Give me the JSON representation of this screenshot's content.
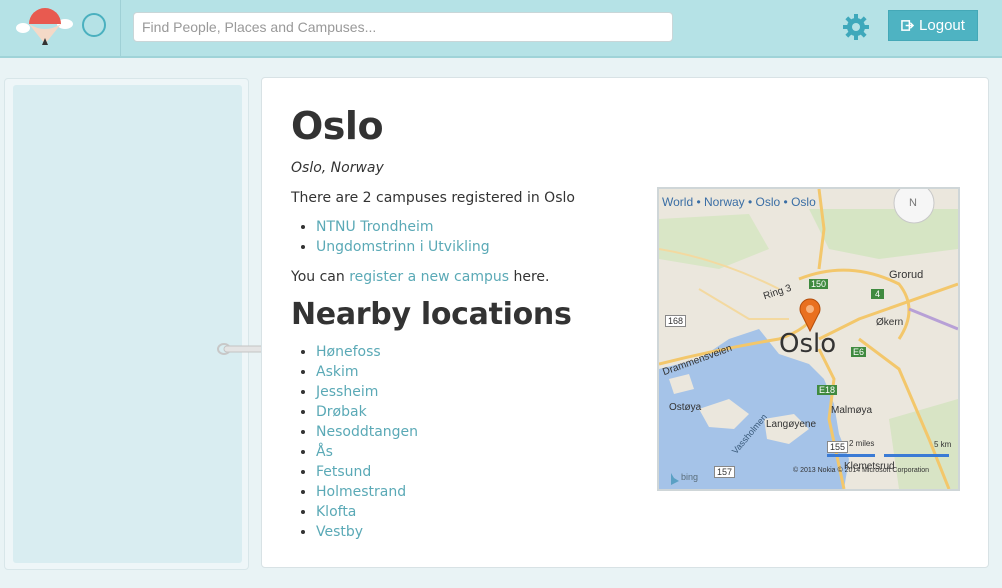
{
  "header": {
    "search_placeholder": "Find People, Places and Campuses...",
    "logout_label": "Logout"
  },
  "page": {
    "title": "Oslo",
    "subtitle": "Oslo, Norway",
    "campus_count_text": "There are 2 campuses registered in Oslo",
    "campuses": [
      "NTNU Trondheim",
      "Ungdomstrinn i Utvikling"
    ],
    "register_prefix": "You can ",
    "register_link": "register a new campus",
    "register_suffix": " here.",
    "nearby_heading": "Nearby locations",
    "nearby": [
      "Hønefoss",
      "Askim",
      "Jessheim",
      "Drøbak",
      "Nesoddtangen",
      "Ås",
      "Fetsund",
      "Holmestrand",
      "Klofta",
      "Vestby"
    ]
  },
  "map": {
    "breadcrumb": "World • Norway • Oslo • Oslo",
    "compass_letter": "N",
    "city_label": "Oslo",
    "labels": {
      "grorud": "Grorud",
      "okern": "Økern",
      "ring3": "Ring 3",
      "drammensveien": "Drammensveien",
      "ostoya": "Ostøya",
      "langoyene": "Langøyene",
      "malmoya": "Malmøya",
      "klemetsrud": "Klemetsrud",
      "vassholmen": "Vassholmen"
    },
    "road_shields": {
      "r150": "150",
      "r4": "4",
      "r168": "168",
      "e6": "E6",
      "e18": "E18",
      "r155": "155",
      "r157": "157"
    },
    "scale_miles": "2 miles",
    "scale_km": "5 km",
    "copyright": "© 2013 Nokia  © 2014 Microsoft Corporation",
    "provider": "bing"
  }
}
